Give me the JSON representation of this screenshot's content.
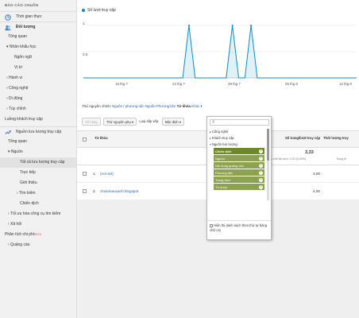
{
  "sidebar": {
    "header": "BÁO CÁO CHUẨN",
    "items": [
      {
        "label": "Thời gian thực"
      },
      {
        "label": "Đối tượng"
      },
      {
        "label": "Tổng quan"
      },
      {
        "label": "▾ Nhân khẩu học"
      },
      {
        "label": "Ngôn ngữ"
      },
      {
        "label": "Vị trí"
      },
      {
        "label": "› Hành vi"
      },
      {
        "label": "› Công nghệ"
      },
      {
        "label": "› Di động"
      },
      {
        "label": "› Tùy chỉnh"
      },
      {
        "label": "Luồng khách truy cập"
      },
      {
        "label": "Nguồn lưu lượng truy cập"
      },
      {
        "label": "Tổng quan"
      },
      {
        "label": "▾ Nguồn"
      },
      {
        "label": "Tất cả lưu lượng truy cập"
      },
      {
        "label": "Trực tiếp"
      },
      {
        "label": "Giới thiệu"
      },
      {
        "label": "› Tìm kiếm"
      },
      {
        "label": "Chiến dịch"
      },
      {
        "label": "› Tối ưu hóa công cụ tìm kiếm"
      },
      {
        "label": "› Xã hội"
      },
      {
        "label": "Phân tích chi phí"
      },
      {
        "label": "› Quảng cáo"
      }
    ],
    "beta": "BETA"
  },
  "chart": {
    "legend": "Số lượt truy cập",
    "series_color": "#058dc7"
  },
  "chart_data": {
    "type": "line",
    "x": [
      "15 thg 7",
      "22 thg 7",
      "29 thg 7",
      "05 thg 8",
      "12 thg 8"
    ],
    "series": [
      {
        "name": "Số lượt truy cập",
        "values": [
          0,
          0,
          0,
          0,
          0,
          0,
          0,
          0,
          0,
          0,
          0,
          0,
          0,
          0,
          0,
          0,
          0,
          1,
          0,
          0,
          0,
          0,
          0,
          0,
          1,
          0,
          0,
          1,
          0,
          0,
          0,
          0,
          0,
          0,
          0,
          0,
          0,
          0,
          0,
          0,
          0,
          0,
          0,
          0,
          0
        ]
      }
    ],
    "yticks": [
      "1",
      "0,5"
    ],
    "ylim": [
      0,
      1
    ],
    "xlabel": "",
    "ylabel": ""
  },
  "filters": {
    "primary_label": "Thứ nguyên chính:",
    "links": [
      "Nguồn / phương tiện",
      "Nguồn",
      "Phương tiện",
      "Từ khóa",
      "Khác ▾"
    ]
  },
  "toolbar": {
    "plot_rows": "Vẽ hàng",
    "secondary_dim": "Thứ nguyên phụ ▾",
    "sort_type": "Loại sắp xếp:",
    "sort_value": "Mặc định ▾"
  },
  "table": {
    "headers": {
      "keyword": "Từ khóa",
      "visits": "Số lượt truy cập",
      "pages_per_visit": "Số trang/lượt truy cập",
      "duration": "Thời lượng truy"
    },
    "summary": {
      "visits_pct": "% trong",
      "ppv_value": "3,33",
      "ppv_sub": "Trung bình cho chế độ xem: 3,33 (0,00%)",
      "dur_sub": "Trung bì"
    },
    "rows": [
      {
        "index": "1.",
        "keyword": "(not set)",
        "ppv": "3,00"
      },
      {
        "index": "2.",
        "keyword": "chuloinauvanh.blogspot",
        "ppv": "4,00"
      }
    ]
  },
  "dropdown": {
    "search_placeholder": "",
    "categories": [
      "Công nghệ",
      "Khách truy cập",
      "Nguồn lưu lượng"
    ],
    "subitems": [
      "Chiến dịch",
      "Nguồn",
      "Nội dung quảng cáo",
      "Phương tiện",
      "Trang đích",
      "Từ khóa"
    ],
    "active_index": 0,
    "footer": "Hiển thị danh sách theo thứ tự bảng chữ cái",
    "accent": "#8da24e"
  }
}
